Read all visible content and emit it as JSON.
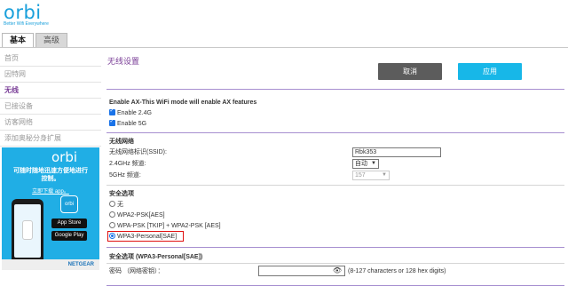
{
  "logo": {
    "word": "orbi",
    "tagline": "Better Wifi Everywhere"
  },
  "tabs": [
    {
      "label": "基本"
    },
    {
      "label": "高级"
    }
  ],
  "sidebar": {
    "items": [
      {
        "label": "首页"
      },
      {
        "label": "因特网"
      },
      {
        "label": "无线"
      },
      {
        "label": "已接设备"
      },
      {
        "label": "访客网络"
      },
      {
        "label": "添加奥秘分身扩展"
      }
    ]
  },
  "ad": {
    "brand": "orbi",
    "headline": "可随时随地迅速方便地进行控制。",
    "more": "立即下载 app。",
    "app_icon_text": "orbi",
    "app_store": "App Store",
    "google_play": "Google Play",
    "footer": "NETGEAR"
  },
  "main": {
    "title": "无线设置",
    "cancel_label": "取消",
    "apply_label": "应用",
    "ax_heading": "Enable AX-This WiFi mode will enable AX features",
    "ax_24": "Enable 2.4G",
    "ax_5": "Enable 5G",
    "wireless_heading": "无线网络",
    "ssid_label": "无线网络标识(SSID):",
    "ssid_value": "Rbk353",
    "ch24_label": "2.4GHz 频道:",
    "ch24_value": "自动",
    "ch5_label": "5GHz 频道:",
    "ch5_value": "157",
    "security_heading": "安全选项",
    "options": [
      "无",
      "WPA2-PSK[AES]",
      "WPA-PSK [TKIP] + WPA2-PSK [AES]",
      "WPA3-Personal[SAE]"
    ],
    "selected_option": "WPA3-Personal[SAE]",
    "wpa3_heading": "安全选项 (WPA3-Personal[SAE])",
    "password_label": "密码 （网络密钥）：",
    "password_hint": "(8-127 characters or 128 hex digits)"
  },
  "colors": {
    "brand": "#1aa0db",
    "accent_purple": "#7a3e97",
    "apply": "#17b7e8",
    "cancel": "#5c5c5c",
    "highlight": "#e01010"
  }
}
